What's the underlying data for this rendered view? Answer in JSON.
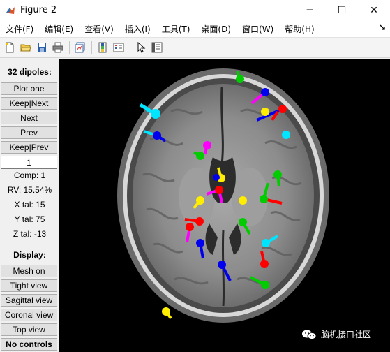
{
  "window": {
    "title": "Figure 2",
    "minimize": "─",
    "maximize": "☐",
    "close": "✕"
  },
  "menu": [
    "文件(F)",
    "编辑(E)",
    "查看(V)",
    "插入(I)",
    "工具(T)",
    "桌面(D)",
    "窗口(W)",
    "帮助(H)"
  ],
  "panel": {
    "title": "32 dipoles:",
    "buttons": [
      "Plot one",
      "Keep|Next",
      "Next",
      "Prev",
      "Keep|Prev"
    ],
    "index_value": "1",
    "comp": "Comp: 1",
    "rv": "RV: 15.54%",
    "x_tal": "X tal: 15",
    "y_tal": "Y tal: 75",
    "z_tal": "Z tal: -13",
    "display_label": "Display:",
    "display_buttons": [
      "Mesh on",
      "Tight view",
      "Sagittal view",
      "Coronal view",
      "Top view",
      "No controls"
    ]
  },
  "watermark": {
    "text": "脑机接口社区"
  },
  "colors": {
    "red": "#ff0000",
    "green": "#00cc00",
    "blue": "#0000ee",
    "magenta": "#ff00ff",
    "cyan": "#00e5ff",
    "yellow": "#ffee00"
  }
}
